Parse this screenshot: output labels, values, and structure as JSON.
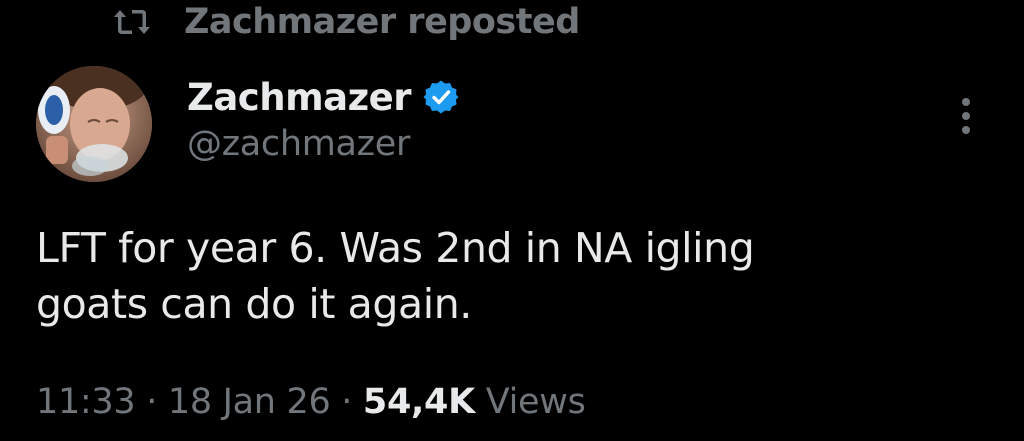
{
  "repost_banner": {
    "icon": "repost-icon",
    "text": "Zachmazer reposted"
  },
  "author": {
    "display_name": "Zachmazer",
    "handle": "@zachmazer",
    "verified_icon": "verified-badge-icon",
    "verified_color": "#1d9bf0"
  },
  "tweet": {
    "lines": [
      "LFT for year 6. Was 2nd in NA igling",
      "goats can do it again."
    ]
  },
  "meta": {
    "time": "11:33",
    "separator1": " · ",
    "date": "18 Jan 26",
    "separator2": " · ",
    "views_count": "54,4K",
    "views_label": " Views"
  },
  "menu": {
    "icon": "more-options-icon"
  },
  "colors": {
    "background": "#000000",
    "primary_text": "#e7e9ea",
    "secondary_text": "#71767b",
    "accent": "#1d9bf0"
  }
}
